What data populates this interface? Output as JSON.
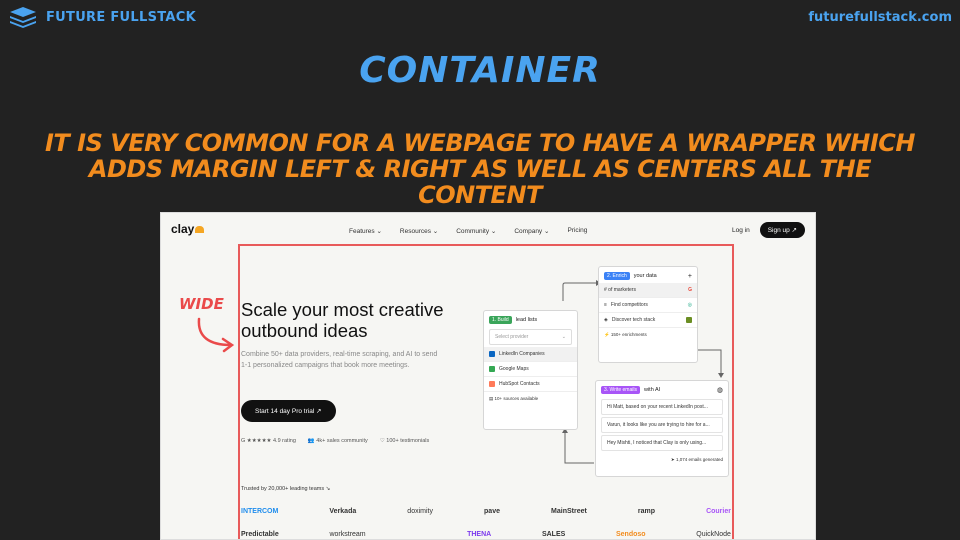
{
  "slide": {
    "brand": "FUTURE FULLSTACK",
    "site_url": "futurefullstack.com",
    "title": "CONTAINER",
    "subtitle": "IT IS VERY COMMON FOR A WEBPAGE TO HAVE A WRAPPER WHICH ADDS MARGIN LEFT & RIGHT AS WELL AS CENTERS ALL THE CONTENT",
    "annotation": "WIDE",
    "colors": {
      "accent_blue": "#4aa3f0",
      "accent_orange": "#f28c1e",
      "container_outline": "#e85a5a",
      "background": "#222222"
    }
  },
  "site": {
    "logo": "clay",
    "nav": [
      "Features ⌄",
      "Resources ⌄",
      "Community ⌄",
      "Company ⌄",
      "Pricing"
    ],
    "login": "Log in",
    "signup": "Sign up ↗",
    "hero": {
      "title": "Scale your most creative outbound ideas",
      "description": "Combine 50+ data providers, real-time scraping, and AI to send 1-1 personalized campaigns that book more meetings.",
      "cta": "Start 14 day Pro trial ↗",
      "proof": [
        "G ★★★★★ 4.9 rating",
        "👥 4k+ sales community",
        "♡ 100+ testimonials"
      ]
    },
    "build_card": {
      "tag": "1. Build",
      "title": "lead lists",
      "select": "Select provider",
      "items": [
        "LinkedIn Companies",
        "Google Maps",
        "HubSpot Contacts"
      ],
      "footer": "10+ sources available"
    },
    "enrich_card": {
      "tag": "2. Enrich",
      "title": "your data",
      "plus": "+",
      "items": [
        "# of marketers",
        "Find competitors",
        "Discover tech stack"
      ],
      "footer": "150+ enrichments"
    },
    "emails_card": {
      "tag": "3. Write emails",
      "title": "with AI",
      "items": [
        "Hi Matt, based on your recent LinkedIn post...",
        "Varun, it looks like you are trying to hire for a...",
        "Hey Mishti, I noticed that Clay is only using..."
      ],
      "footer": "1,074 emails generated"
    },
    "trusted": "Trusted by 20,000+ leading teams ↘",
    "logos_row1": [
      "INTERCOM",
      "Verkada",
      "doximity",
      "pave",
      "MainStreet",
      "ramp",
      "Courier"
    ],
    "logos_row2": [
      "Predictable",
      "workstream",
      "",
      "THENA",
      "SALES",
      "Sendoso",
      "QuickNode"
    ]
  }
}
